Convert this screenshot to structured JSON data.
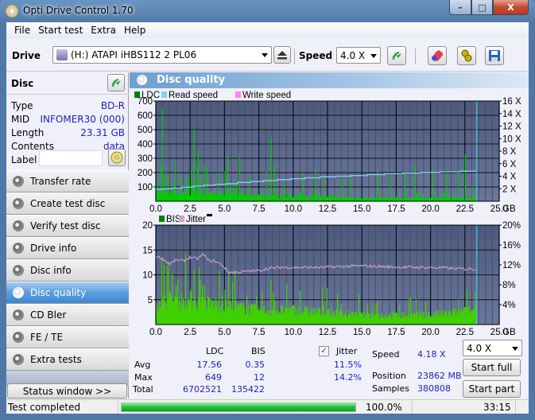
{
  "window": {
    "title": "Opti Drive Control 1.70",
    "controls": {
      "minimize": "–",
      "maximize": "□",
      "close": "X"
    }
  },
  "menu": [
    "File",
    "Start test",
    "Extra",
    "Help"
  ],
  "toolbar": {
    "drive_label": "Drive",
    "drive_value": "(H:)   ATAPI iHBS112   2 PL06",
    "speed_label": "Speed",
    "speed_value": "4.0 X",
    "icons": [
      "eject-icon",
      "refresh-icon",
      "erase-icon",
      "settings-icon",
      "save-icon"
    ]
  },
  "disc": {
    "title": "Disc",
    "rows": [
      {
        "label": "Type",
        "value": "BD-R"
      },
      {
        "label": "MID",
        "value": "INFOMER30 (000)"
      },
      {
        "label": "Length",
        "value": "23.31 GB"
      },
      {
        "label": "Contents",
        "value": "data"
      }
    ],
    "label_field": {
      "label": "Label",
      "value": ""
    }
  },
  "nav": [
    {
      "label": "Transfer rate",
      "active": false
    },
    {
      "label": "Create test disc",
      "active": false
    },
    {
      "label": "Verify test disc",
      "active": false
    },
    {
      "label": "Drive info",
      "active": false
    },
    {
      "label": "Disc info",
      "active": false
    },
    {
      "label": "Disc quality",
      "active": true
    },
    {
      "label": "CD Bler",
      "active": false
    },
    {
      "label": "FE / TE",
      "active": false
    },
    {
      "label": "Extra tests",
      "active": false
    }
  ],
  "status_window_button": "Status window >>",
  "panel_title": "Disc quality",
  "colors": {
    "ldc": "#00cc00",
    "ldc_legend": "#008000",
    "read_speed": "#87cefa",
    "write_speed": "#ff80ff",
    "bis": "#40d000",
    "jitter": "#d8a0d8",
    "plot_bg_top": "#4a5a80",
    "plot_bg_bottom": "#6878a0",
    "end_marker": "#40c8f0"
  },
  "chart_data": [
    {
      "type": "bar",
      "legend": [
        "LDC",
        "Read speed",
        "Write speed"
      ],
      "xlabel": "GB",
      "x_ticks": [
        "0.0",
        "2.5",
        "5.0",
        "7.5",
        "10.0",
        "12.5",
        "15.0",
        "17.5",
        "20.0",
        "22.5",
        "25.0"
      ],
      "xlim": [
        0,
        25
      ],
      "y_left_ticks": [
        "100",
        "200",
        "300",
        "400",
        "500",
        "600",
        "700"
      ],
      "ylim_left": [
        0,
        700
      ],
      "y_right_ticks": [
        "2 X",
        "4 X",
        "6 X",
        "8 X",
        "10 X",
        "12 X",
        "14 X",
        "16 X"
      ],
      "ylim_right": [
        0,
        16
      ],
      "data_end_gb": 23.31,
      "ldc_baseline": [
        [
          0,
          60
        ],
        [
          2.5,
          55
        ],
        [
          5,
          50
        ],
        [
          7.5,
          38
        ],
        [
          10,
          30
        ],
        [
          15,
          25
        ],
        [
          20,
          22
        ],
        [
          23.3,
          20
        ]
      ],
      "ldc_spikes": [
        [
          0.05,
          150
        ],
        [
          0.3,
          255
        ],
        [
          0.45,
          649
        ],
        [
          0.7,
          200
        ],
        [
          0.9,
          190
        ],
        [
          1.4,
          280
        ],
        [
          1.8,
          180
        ],
        [
          2.2,
          160
        ],
        [
          2.55,
          220
        ],
        [
          2.75,
          500
        ],
        [
          3.0,
          240
        ],
        [
          3.05,
          355
        ],
        [
          3.5,
          260
        ],
        [
          3.7,
          230
        ],
        [
          4.5,
          200
        ],
        [
          5.0,
          210
        ],
        [
          5.2,
          320
        ],
        [
          6.05,
          310
        ],
        [
          6.8,
          170
        ],
        [
          8.0,
          210
        ],
        [
          8.35,
          450
        ],
        [
          8.6,
          260
        ],
        [
          9.3,
          160
        ],
        [
          10.7,
          200
        ],
        [
          11.6,
          215
        ],
        [
          12.2,
          180
        ],
        [
          13.5,
          155
        ],
        [
          14.1,
          175
        ],
        [
          16.1,
          210
        ],
        [
          17.0,
          180
        ],
        [
          18.1,
          200
        ],
        [
          18.85,
          250
        ],
        [
          20.1,
          225
        ],
        [
          21.1,
          195
        ],
        [
          22.0,
          215
        ],
        [
          22.5,
          330
        ],
        [
          23.0,
          100
        ]
      ],
      "read_speed_steps": [
        [
          0,
          1.9
        ],
        [
          0.55,
          2.0
        ],
        [
          1.15,
          2.1
        ],
        [
          1.9,
          2.25
        ],
        [
          2.7,
          2.4
        ],
        [
          3.5,
          2.55
        ],
        [
          4.3,
          2.7
        ],
        [
          5.1,
          2.8
        ],
        [
          5.95,
          3.0
        ],
        [
          6.9,
          3.15
        ],
        [
          7.85,
          3.3
        ],
        [
          8.85,
          3.45
        ],
        [
          9.85,
          3.6
        ],
        [
          10.85,
          3.75
        ],
        [
          11.95,
          3.9
        ],
        [
          13.05,
          4.0
        ],
        [
          14.2,
          4.1
        ],
        [
          15.4,
          4.25
        ],
        [
          16.65,
          4.4
        ],
        [
          17.95,
          4.5
        ],
        [
          19.3,
          4.6
        ],
        [
          20.7,
          4.7
        ],
        [
          22.2,
          4.8
        ],
        [
          23.31,
          4.8
        ]
      ],
      "write_speed": []
    },
    {
      "type": "bar",
      "legend": [
        "BIS",
        "Jitter"
      ],
      "xlabel": "GB",
      "x_ticks": [
        "0.0",
        "2.5",
        "5.0",
        "7.5",
        "10.0",
        "12.5",
        "15.0",
        "17.5",
        "20.0",
        "22.5",
        "25.0"
      ],
      "xlim": [
        0,
        25
      ],
      "y_left_ticks": [
        "5",
        "10",
        "15",
        "20"
      ],
      "ylim_left": [
        0,
        20
      ],
      "y_right_ticks": [
        "4%",
        "8%",
        "12%",
        "16%",
        "20%"
      ],
      "ylim_right": [
        0,
        20
      ],
      "data_end_gb": 23.31,
      "bis_baseline": [
        [
          0,
          5
        ],
        [
          2.5,
          5
        ],
        [
          5,
          4
        ],
        [
          7.5,
          3
        ],
        [
          10,
          3
        ],
        [
          15,
          2
        ],
        [
          20,
          2
        ],
        [
          23.3,
          3
        ]
      ],
      "bis_spikes": [
        [
          0.4,
          8
        ],
        [
          0.55,
          12
        ],
        [
          0.8,
          6
        ],
        [
          2.5,
          7
        ],
        [
          2.75,
          11
        ],
        [
          3.2,
          9
        ],
        [
          3.5,
          8
        ],
        [
          4.8,
          6
        ],
        [
          5.0,
          7
        ],
        [
          8.35,
          9
        ],
        [
          8.6,
          5
        ],
        [
          10.0,
          4
        ],
        [
          16.0,
          4
        ],
        [
          18.5,
          4
        ],
        [
          22.0,
          5
        ],
        [
          22.6,
          7
        ]
      ],
      "jitter_percent": [
        [
          0,
          13.8
        ],
        [
          0.5,
          13.2
        ],
        [
          1.0,
          12.2
        ],
        [
          1.5,
          13.0
        ],
        [
          2.0,
          12.8
        ],
        [
          2.5,
          13.5
        ],
        [
          3.0,
          13.2
        ],
        [
          3.5,
          14.2
        ],
        [
          3.8,
          12.8
        ],
        [
          4.3,
          12.8
        ],
        [
          4.9,
          11.8
        ],
        [
          5.3,
          10.5
        ],
        [
          6.0,
          10.5
        ],
        [
          7.0,
          10.8
        ],
        [
          7.5,
          10.8
        ],
        [
          8.0,
          11.2
        ],
        [
          9.0,
          11.5
        ],
        [
          10.0,
          11.5
        ],
        [
          12.0,
          11.5
        ],
        [
          14.0,
          11.7
        ],
        [
          15.0,
          11.8
        ],
        [
          17.0,
          11.6
        ],
        [
          19.0,
          11.5
        ],
        [
          21.0,
          11.4
        ],
        [
          22.0,
          11.2
        ],
        [
          23.3,
          11.2
        ]
      ]
    }
  ],
  "stats": {
    "headers": [
      "LDC",
      "BIS"
    ],
    "jitter_checked": true,
    "jitter_label": "Jitter",
    "rows": [
      {
        "label": "Avg",
        "ldc": "17.56",
        "bis": "0.35",
        "jitter": "11.5%"
      },
      {
        "label": "Max",
        "ldc": "649",
        "bis": "12",
        "jitter": "14.2%"
      },
      {
        "label": "Total",
        "ldc": "6702521",
        "bis": "135422",
        "jitter": ""
      }
    ],
    "speed_label": "Speed",
    "speed_value": "4.18 X",
    "position_label": "Position",
    "position_value": "23862 MB",
    "samples_label": "Samples",
    "samples_value": "380808",
    "speed_select": "4.0 X",
    "start_full": "Start full",
    "start_part": "Start part"
  },
  "statusbar": {
    "text": "Test completed",
    "progress": 100.0,
    "progress_text": "100.0%",
    "time": "33:15"
  }
}
